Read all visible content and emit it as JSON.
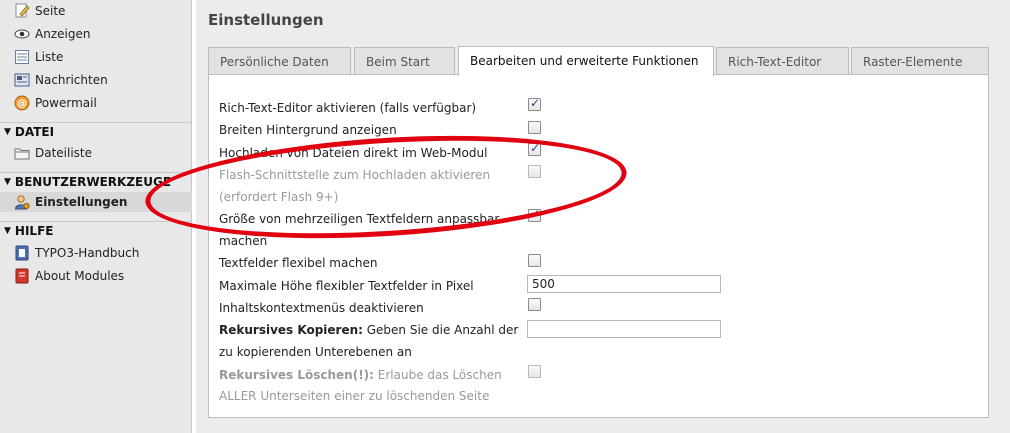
{
  "sidebar": {
    "web_items": [
      {
        "label": "Seite",
        "icon": "page-edit-icon"
      },
      {
        "label": "Anzeigen",
        "icon": "eye-icon"
      },
      {
        "label": "Liste",
        "icon": "list-icon"
      },
      {
        "label": "Nachrichten",
        "icon": "news-icon"
      },
      {
        "label": "Powermail",
        "icon": "powermail-icon"
      }
    ],
    "sections": {
      "datei": "DATEI",
      "benutzer": "BENUTZERWERKZEUGE",
      "hilfe": "HILFE"
    },
    "datei_items": [
      {
        "label": "Dateiliste",
        "icon": "folder-icon"
      }
    ],
    "benutzer_items": [
      {
        "label": "Einstellungen",
        "icon": "user-settings-icon"
      }
    ],
    "hilfe_items": [
      {
        "label": "TYPO3-Handbuch",
        "icon": "manual-icon"
      },
      {
        "label": "About Modules",
        "icon": "book-icon"
      }
    ]
  },
  "main": {
    "title": "Einstellungen",
    "tabs": [
      {
        "label": "Persönliche Daten",
        "active": false
      },
      {
        "label": "Beim Start",
        "active": false
      },
      {
        "label": "Bearbeiten und erweiterte Funktionen",
        "active": true
      },
      {
        "label": "Rich-Text-Editor",
        "active": false
      },
      {
        "label": "Raster-Elemente",
        "active": false
      }
    ],
    "settings": [
      {
        "label": "Rich-Text-Editor aktivieren (falls verfügbar)",
        "checked": true
      },
      {
        "label": "Breiten Hintergrund anzeigen",
        "checked": false
      },
      {
        "label": "Hochladen von Dateien direkt im Web-Modul",
        "checked": true
      },
      {
        "label_line1": "Flash-Schnittstelle zum Hochladen aktivieren",
        "label_line2": "(erfordert Flash 9+)",
        "checked": false,
        "disabled": true
      },
      {
        "label_line1": "Größe von mehrzeiligen Textfeldern anpassbar",
        "label_line2": "machen",
        "checked": true
      },
      {
        "label": "Textfelder flexibel machen",
        "checked": false
      },
      {
        "label": "Maximale Höhe flexibler Textfelder in Pixel",
        "value": "500"
      },
      {
        "label": "Inhaltskontextmenüs deaktivieren",
        "checked": false
      },
      {
        "bold": "Rekursives Kopieren:",
        "label_line1": " Geben Sie die Anzahl der",
        "label_line2": "zu kopierenden Unterebenen an",
        "value": ""
      },
      {
        "bold": "Rekursives Löschen(!):",
        "label_line1": " Erlaube das Löschen",
        "label_line2": "ALLER Unterseiten einer zu löschenden Seite",
        "checked": false,
        "disabled": true
      }
    ]
  },
  "colors": {
    "annotation": "#e10010",
    "sidebar_bg": "#e8e8e8",
    "content_bg": "#ececec",
    "check": "#2a4a8a"
  }
}
